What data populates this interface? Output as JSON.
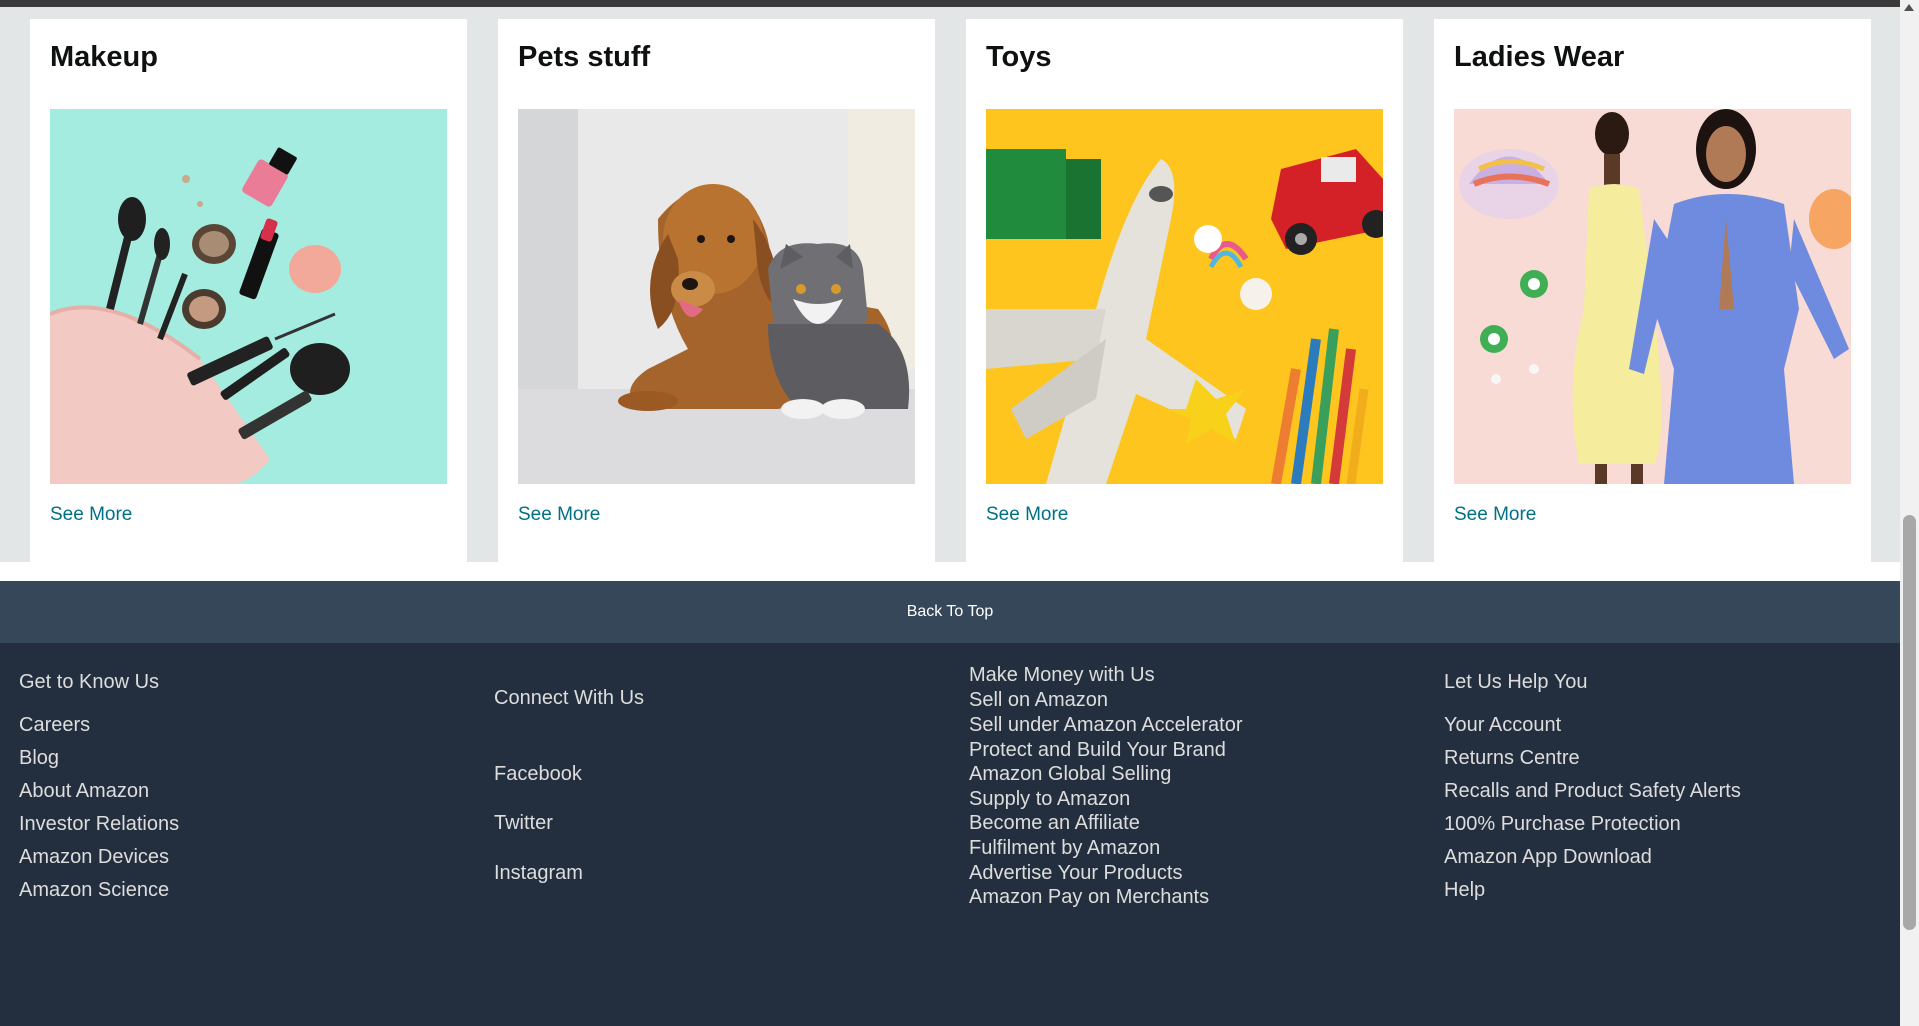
{
  "cards": [
    {
      "title": "Makeup",
      "link": "See More"
    },
    {
      "title": "Pets stuff",
      "link": "See More"
    },
    {
      "title": "Toys",
      "link": "See More"
    },
    {
      "title": "Ladies Wear",
      "link": "See More"
    }
  ],
  "back_to_top": "Back To Top",
  "footer": {
    "col1": {
      "heading": "Get to Know Us",
      "links": [
        "Careers",
        "Blog",
        "About Amazon",
        "Investor Relations",
        "Amazon Devices",
        "Amazon Science"
      ]
    },
    "col2": {
      "heading": "Connect With Us",
      "links": [
        "Facebook",
        "Twitter",
        "Instagram"
      ]
    },
    "col3": {
      "heading": "Make Money with Us",
      "links": [
        "Sell on Amazon",
        "Sell under Amazon Accelerator",
        "Protect and Build Your Brand",
        "Amazon Global Selling",
        "Supply to Amazon",
        "Become an Affiliate",
        "Fulfilment by Amazon",
        "Advertise Your Products",
        "Amazon Pay on Merchants"
      ]
    },
    "col4": {
      "heading": "Let Us Help You",
      "links": [
        "Your Account",
        "Returns Centre",
        "Recalls and Product Safety Alerts",
        "100% Purchase Protection",
        "Amazon App Download",
        "Help"
      ]
    }
  },
  "colors": {
    "link": "#007185",
    "footer_bg": "#232f3e",
    "back_top_bg": "#37475a",
    "page_bg": "#e3e6e6"
  }
}
